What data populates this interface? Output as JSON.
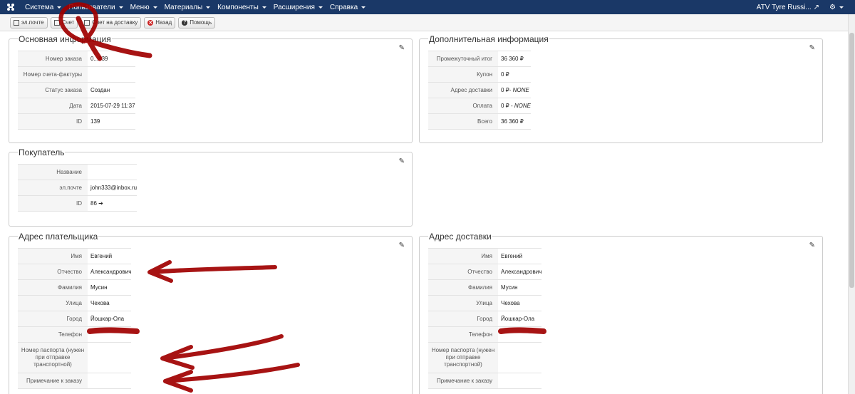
{
  "navbar": {
    "menu": [
      "Система",
      "Пользователи",
      "Меню",
      "Материалы",
      "Компоненты",
      "Расширения",
      "Справка"
    ],
    "site_name": "ATV Tyre Russi..."
  },
  "toolbar": {
    "email": "эл.почте",
    "invoice": "Счет",
    "delivery_invoice": "Счет на доставку",
    "back": "Назад",
    "help": "Помощь"
  },
  "main_info": {
    "title": "Основная информация",
    "rows": [
      {
        "label": "Номер заказа",
        "value": "0...839"
      },
      {
        "label": "Номер счета-фактуры",
        "value": ""
      },
      {
        "label": "Статус заказа",
        "value": "Создан"
      },
      {
        "label": "Дата",
        "value": "2015-07-29 11:37"
      },
      {
        "label": "ID",
        "value": "139"
      }
    ]
  },
  "extra_info": {
    "title": "Дополнительная информация",
    "rows": [
      {
        "label": "Промежуточный итог",
        "value": "36 360 ₽",
        "italic": ""
      },
      {
        "label": "Купон",
        "value": "0 ₽",
        "italic": ""
      },
      {
        "label": "Адрес доставки",
        "value": "0 ₽- ",
        "italic": "NONE"
      },
      {
        "label": "Оплата",
        "value": "0 ₽ - ",
        "italic": "NONE"
      },
      {
        "label": "Всего",
        "value": "36 360 ₽",
        "italic": ""
      }
    ]
  },
  "buyer": {
    "title": "Покупатель",
    "rows": [
      {
        "label": "Название",
        "value": ""
      },
      {
        "label": "эл.почте",
        "value": "john333@inbox.ru"
      },
      {
        "label": "ID",
        "value": "86"
      }
    ]
  },
  "billing": {
    "title": "Адрес плательщика",
    "rows": [
      {
        "label": "Имя",
        "value": "Евгений"
      },
      {
        "label": "Отчество",
        "value": "Александрович"
      },
      {
        "label": "Фамилия",
        "value": "Мусин"
      },
      {
        "label": "Улица",
        "value": "Чехова"
      },
      {
        "label": "Город",
        "value": "Йошкар-Ола"
      },
      {
        "label": "Телефон",
        "value": ""
      },
      {
        "label": "Номер паспорта (нужен при отправке транспортной)",
        "value": ""
      },
      {
        "label": "Примечание к заказу",
        "value": ""
      }
    ]
  },
  "shipping": {
    "title": "Адрес доставки",
    "rows": [
      {
        "label": "Имя",
        "value": "Евгений"
      },
      {
        "label": "Отчество",
        "value": "Александрович"
      },
      {
        "label": "Фамилия",
        "value": "Мусин"
      },
      {
        "label": "Улица",
        "value": "Чехова"
      },
      {
        "label": "Город",
        "value": "Йошкар-Ола"
      },
      {
        "label": "Телефон",
        "value": ""
      },
      {
        "label": "Номер паспорта (нужен при отправке транспортной)",
        "value": ""
      },
      {
        "label": "Примечание к заказу",
        "value": ""
      }
    ]
  },
  "colors": {
    "navbar": "#1a3867",
    "annotation": "#a00000"
  }
}
